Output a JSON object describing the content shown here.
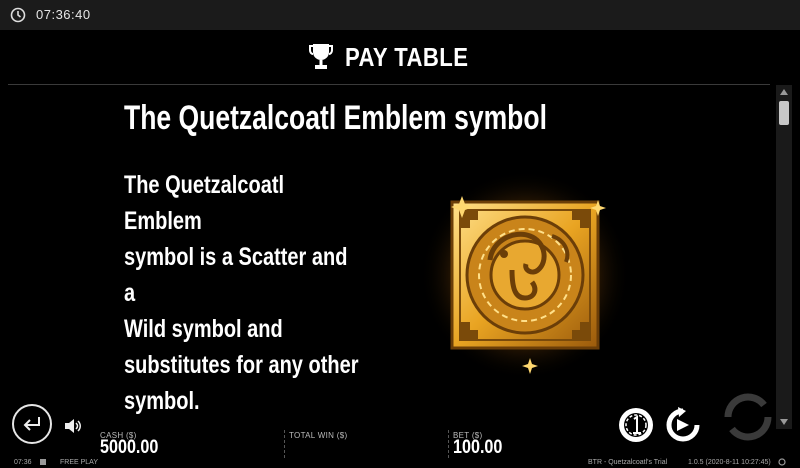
{
  "status_bar": {
    "clock": "07:36:40"
  },
  "header": {
    "title": "PAY TABLE"
  },
  "section": {
    "title": "The Quetzalcoatl Emblem symbol",
    "description_lines": [
      "The Quetzalcoatl Emblem",
      "symbol is a Scatter and a",
      "Wild symbol and",
      "substitutes for any other",
      "symbol."
    ]
  },
  "bottom_bar": {
    "cash_label": "CASH ($)",
    "cash_value": "5000.00",
    "total_win_label": "TOTAL WIN ($)",
    "total_win_value": "",
    "bet_label": "BET ($)",
    "bet_value": "100.00"
  },
  "footer": {
    "time": "07:36",
    "mode": "FREE PLAY",
    "game": "BTR - Quetzalcoatl's Trial",
    "version": "1.0.5 (2020-8-11 10:27:45)"
  },
  "icons": {
    "clock": "clock-icon",
    "header": "trophy-icon",
    "back": "return-arrow-icon",
    "sound": "speaker-icon",
    "coin": "coin-icon",
    "spin": "spin-icon",
    "autoplay": "autoplay-icon"
  },
  "colors": {
    "gold": "#f2b233",
    "gold_dark": "#8a5a10",
    "background": "#000000"
  }
}
